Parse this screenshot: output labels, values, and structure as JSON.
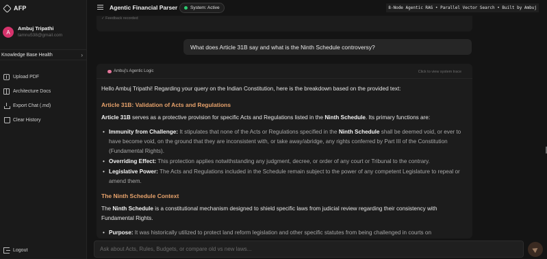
{
  "brand": {
    "name": "AFP"
  },
  "user": {
    "initial": "A",
    "name": "Ambuj Tripathi",
    "email": "tamnu538@gmail.com"
  },
  "sidebar": {
    "kb_health": "Knowledge Base Health",
    "items": [
      {
        "label": "Upload PDF",
        "icon": "upload-icon"
      },
      {
        "label": "Architecture Docs",
        "icon": "book-icon"
      },
      {
        "label": "Export Chat (.md)",
        "icon": "export-icon"
      },
      {
        "label": "Clear History",
        "icon": "trash-icon"
      }
    ],
    "logout": "Logout"
  },
  "header": {
    "title": "Agentic Financial Parser",
    "status": "System: Active",
    "banner": "8-Node Agentic RAG • Parallel Vector Search • Built by Ambuj"
  },
  "chat": {
    "feedback": "✓ Feedback recorded",
    "user_message": "What does Article 31B say and what is the Ninth Schedule controversy?",
    "logic_label": "Ambuj's Agentic Logic",
    "trace_link": "Click to view system trace",
    "answer": {
      "intro": "Hello Ambuj Tripathi! Regarding your query on the Indian Constitution, here is the breakdown based on the provided text:",
      "h1": "Article 31B: Validation of Acts and Regulations",
      "p1": {
        "a": "Article 31B",
        "b": " serves as a protective provision for specific Acts and Regulations listed in the ",
        "c": "Ninth Schedule",
        "d": ". Its primary functions are:"
      },
      "bullets1": [
        {
          "title": "Immunity from Challenge:",
          "t1": " It stipulates that none of the Acts or Regulations specified in the ",
          "b2": "Ninth Schedule",
          "t2": " shall be deemed void, or ever to have become void, on the ground that they are inconsistent with, or take away/abridge, any rights conferred by Part III of the Constitution (Fundamental Rights)."
        },
        {
          "title": "Overriding Effect:",
          "t1": " This protection applies notwithstanding any judgment, decree, or order of any court or Tribunal to the contrary."
        },
        {
          "title": "Legislative Power:",
          "t1": " The Acts and Regulations included in the Schedule remain subject to the power of any competent Legislature to repeal or amend them."
        }
      ],
      "h2": "The Ninth Schedule Context",
      "p2": {
        "a": "The ",
        "b": "Ninth Schedule",
        "c": " is a constitutional mechanism designed to shield specific laws from judicial review regarding their consistency with Fundamental Rights."
      },
      "bullets2": [
        {
          "title": "Purpose:",
          "t1": " It was historically utilized to protect land reform legislation and other specific statutes from being challenged in courts on"
        }
      ]
    }
  },
  "composer": {
    "placeholder": "Ask about Acts, Rules, Budgets, or compare old vs new laws..."
  },
  "colors": {
    "accent": "#e8a36c",
    "status_dot": "#2ecc71",
    "avatar": "#d6336c"
  }
}
